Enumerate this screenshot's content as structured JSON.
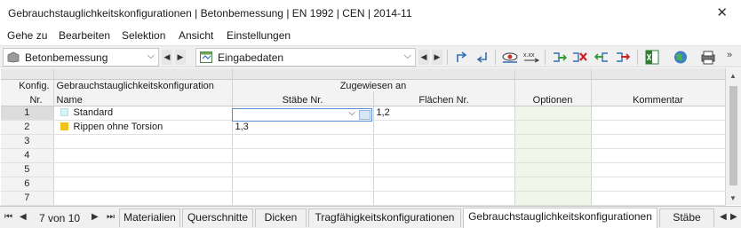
{
  "window": {
    "title": "Gebrauchstauglichkeitskonfigurationen | Betonbemessung | EN 1992 | CEN | 2014-11",
    "close_icon": "close-icon"
  },
  "menu": [
    "Gehe zu",
    "Bearbeiten",
    "Selektion",
    "Ansicht",
    "Einstellungen"
  ],
  "toolbar": {
    "module_combo": "Betonbemessung",
    "table_combo": "Eingabedaten",
    "icons": [
      "arrow-up-icon",
      "arrow-down-icon",
      "view-icon",
      "numbering-icon",
      "import-icon",
      "delete-icon",
      "move-left-icon",
      "move-right-icon",
      "excel-export-icon",
      "globe-icon",
      "print-icon",
      "overflow-icon"
    ]
  },
  "table": {
    "headers": {
      "col_a_line1": "Konfig.",
      "col_a_line2": "Nr.",
      "col_b_line1": "Gebrauchstauglichkeitskonfiguration",
      "col_b_line2": "Name",
      "assigned_group": "Zugewiesen an",
      "col_c": "Stäbe Nr.",
      "col_d": "Flächen Nr.",
      "col_e": "Optionen",
      "col_f": "Kommentar"
    },
    "rows": [
      {
        "no": "1",
        "name": "Standard",
        "color": "#d8f4f8",
        "members": "",
        "surfaces": "1,2",
        "options": "",
        "comment": ""
      },
      {
        "no": "2",
        "name": "Rippen ohne Torsion",
        "color": "#f2c11a",
        "members": "1,3",
        "surfaces": "",
        "options": "",
        "comment": ""
      },
      {
        "no": "3",
        "name": "",
        "members": "",
        "surfaces": "",
        "options": "",
        "comment": ""
      },
      {
        "no": "4",
        "name": "",
        "members": "",
        "surfaces": "",
        "options": "",
        "comment": ""
      },
      {
        "no": "5",
        "name": "",
        "members": "",
        "surfaces": "",
        "options": "",
        "comment": ""
      },
      {
        "no": "6",
        "name": "",
        "members": "",
        "surfaces": "",
        "options": "",
        "comment": ""
      },
      {
        "no": "7",
        "name": "",
        "members": "",
        "surfaces": "",
        "options": "",
        "comment": ""
      }
    ]
  },
  "pager": {
    "label": "7 von 10"
  },
  "tabs": [
    "Materialien",
    "Querschnitte",
    "Dicken",
    "Tragfähigkeitskonfigurationen",
    "Gebrauchstauglichkeitskonfigurationen",
    "Stäbe"
  ],
  "active_tab": "Gebrauchstauglichkeitskonfigurationen"
}
